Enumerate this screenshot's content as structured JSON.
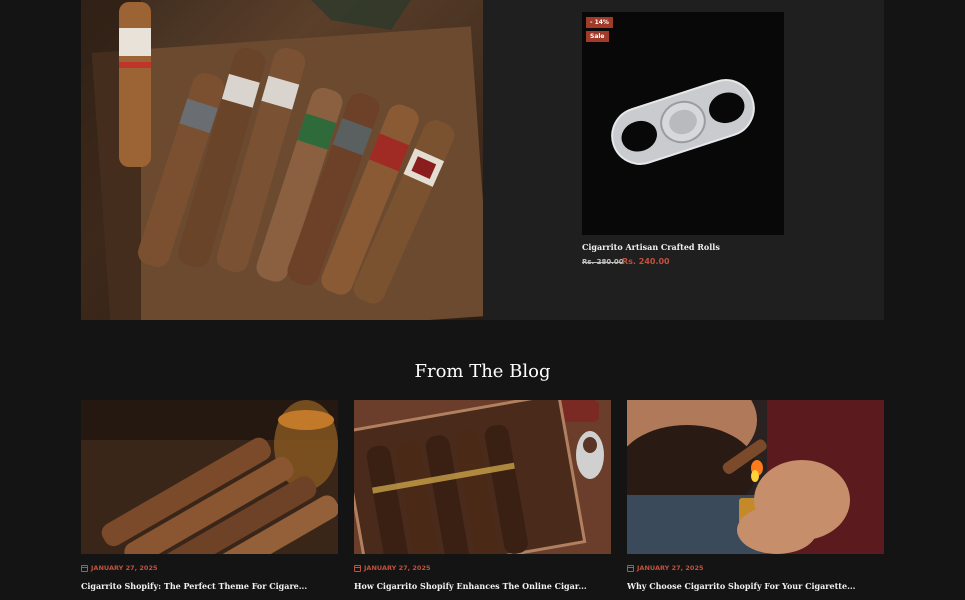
{
  "product": {
    "discount_badge": "- 14%",
    "sale_badge": "Sale",
    "title": "Cigarrito Artisan Crafted Rolls",
    "price_old": "Rs. 280.00",
    "price_new": "Rs. 240.00"
  },
  "blog": {
    "heading": "From The Blog",
    "posts": [
      {
        "date": "JANUARY 27, 2025",
        "title": "Cigarrito Shopify: The Perfect Theme For Cigare..."
      },
      {
        "date": "JANUARY 27, 2025",
        "title": "How Cigarrito Shopify Enhances The Online Cigar..."
      },
      {
        "date": "JANUARY 27, 2025",
        "title": "Why Choose Cigarrito Shopify For Your Cigarette..."
      }
    ]
  },
  "colors": {
    "background": "#141414",
    "panel": "#1f1f1f",
    "accent": "#c0513c",
    "badge": "#a23a2a"
  }
}
